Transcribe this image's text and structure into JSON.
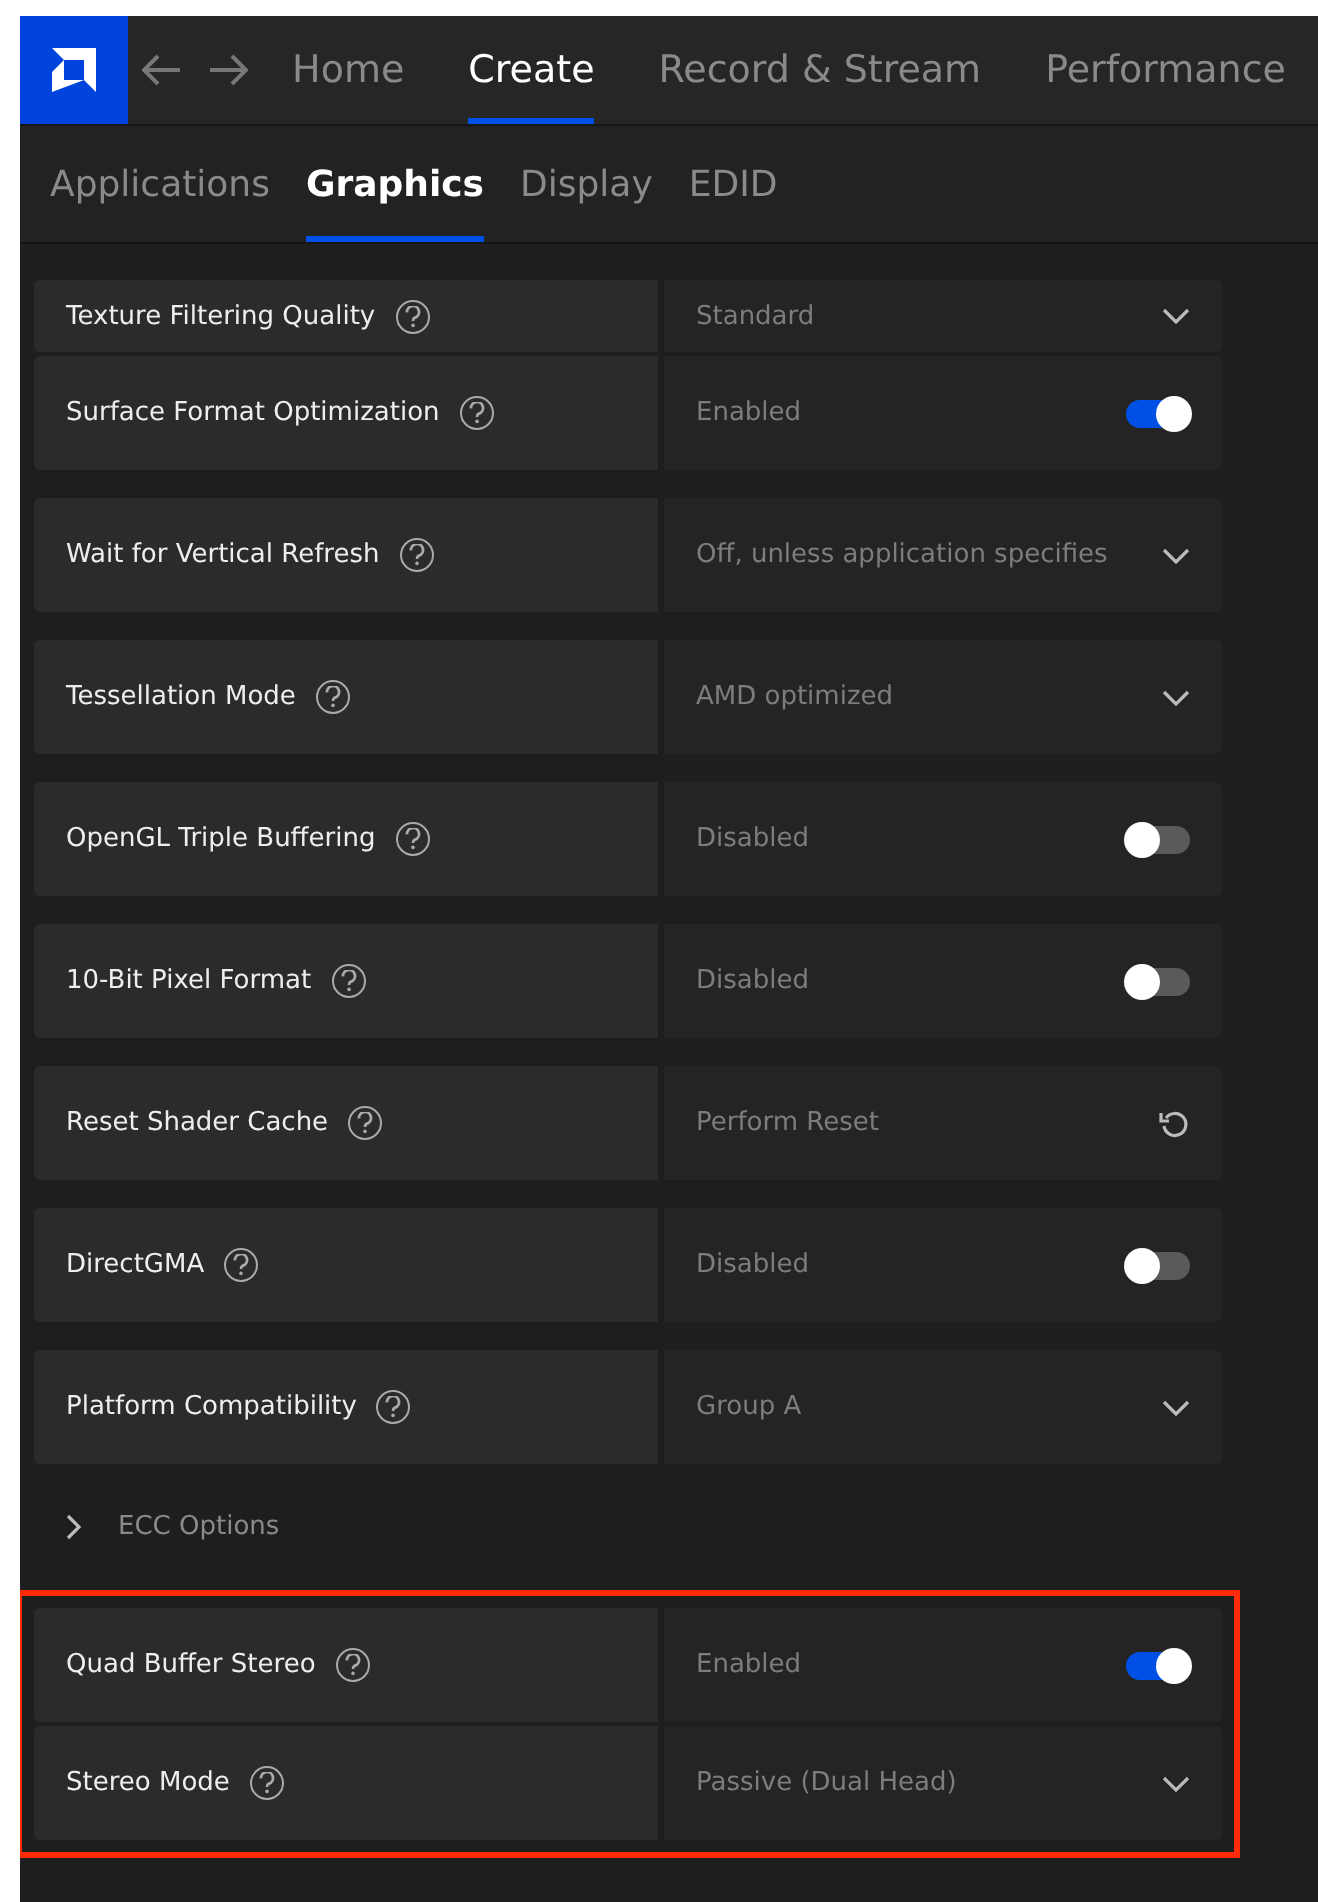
{
  "top_nav": {
    "items": [
      {
        "label": "Home",
        "selected": false
      },
      {
        "label": "Create",
        "selected": true
      },
      {
        "label": "Record & Stream",
        "selected": false
      },
      {
        "label": "Performance",
        "selected": false
      }
    ]
  },
  "sub_nav": {
    "items": [
      {
        "label": "Applications",
        "selected": false
      },
      {
        "label": "Graphics",
        "selected": true
      },
      {
        "label": "Display",
        "selected": false
      },
      {
        "label": "EDID",
        "selected": false
      }
    ]
  },
  "sections": [
    {
      "kind": "card",
      "highlighted": false,
      "rows": [
        {
          "kind": "dropdown",
          "label": "Texture Filtering Quality",
          "value": "Standard"
        },
        {
          "kind": "toggle",
          "label": "Surface Format Optimization",
          "value": "Enabled",
          "on": true
        }
      ]
    },
    {
      "kind": "card",
      "highlighted": false,
      "rows": [
        {
          "kind": "dropdown",
          "label": "Wait for Vertical Refresh",
          "value": "Off, unless application specifies"
        }
      ]
    },
    {
      "kind": "card",
      "highlighted": false,
      "rows": [
        {
          "kind": "dropdown",
          "label": "Tessellation Mode",
          "value": "AMD optimized"
        }
      ]
    },
    {
      "kind": "card",
      "highlighted": false,
      "rows": [
        {
          "kind": "toggle",
          "label": "OpenGL Triple Buffering",
          "value": "Disabled",
          "on": false
        }
      ]
    },
    {
      "kind": "card",
      "highlighted": false,
      "rows": [
        {
          "kind": "toggle",
          "label": "10-Bit Pixel Format",
          "value": "Disabled",
          "on": false
        }
      ]
    },
    {
      "kind": "card",
      "highlighted": false,
      "rows": [
        {
          "kind": "action",
          "label": "Reset Shader Cache",
          "value": "Perform Reset"
        }
      ]
    },
    {
      "kind": "card",
      "highlighted": false,
      "rows": [
        {
          "kind": "toggle",
          "label": "DirectGMA",
          "value": "Disabled",
          "on": false
        }
      ]
    },
    {
      "kind": "card",
      "highlighted": false,
      "rows": [
        {
          "kind": "dropdown",
          "label": "Platform Compatibility",
          "value": "Group A"
        }
      ]
    },
    {
      "kind": "expander",
      "label": "ECC Options",
      "expanded": false
    },
    {
      "kind": "card",
      "highlighted": true,
      "rows": [
        {
          "kind": "toggle",
          "label": "Quad Buffer Stereo",
          "value": "Enabled",
          "on": true
        },
        {
          "kind": "dropdown",
          "label": "Stereo Mode",
          "value": "Passive (Dual Head)"
        }
      ]
    }
  ]
}
